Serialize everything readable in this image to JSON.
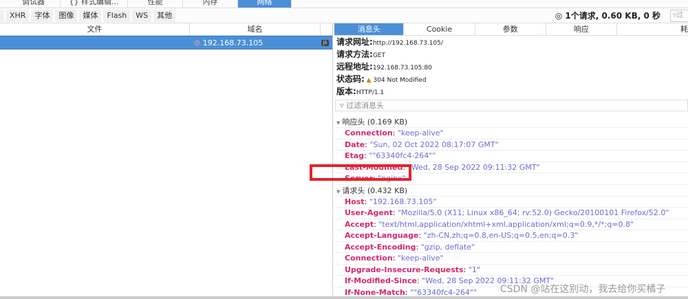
{
  "toolbox_tabs": [
    {
      "label": "调试器"
    },
    {
      "label": "{} 样式编辑..."
    },
    {
      "label": "性能"
    },
    {
      "label": "内存"
    },
    {
      "label": "网络"
    }
  ],
  "filters": [
    "XHR",
    "字体",
    "图像",
    "媒体",
    "Flash",
    "WS",
    "其他"
  ],
  "summary": "1个请求, 0.60 KB, 0 秒",
  "filter_urls_placeholder": "过",
  "columns": {
    "file": "文件",
    "domain": "域名"
  },
  "selected_request": {
    "domain": "192.168.73.105",
    "type_badge": "JS"
  },
  "detail_tabs": [
    "消息头",
    "Cookie",
    "参数",
    "响应",
    "耗"
  ],
  "summary_rows": [
    {
      "label": "请求网址:",
      "value": "http://192.168.73.105/"
    },
    {
      "label": "请求方法:",
      "value": "GET"
    },
    {
      "label": "远程地址:",
      "value": "192.168.73.105:80"
    },
    {
      "label": "状态码:",
      "value": "304  Not  Modified"
    },
    {
      "label": "版本:",
      "value": "HTTP/1.1"
    }
  ],
  "header_filter_placeholder": "过滤消息头",
  "response_headers": {
    "title": "响应头 (0.169 KB)",
    "items": [
      {
        "name": "Connection",
        "value": "\"keep-alive\""
      },
      {
        "name": "Date",
        "value": "\"Sun, 02 Oct 2022 08:17:07 GMT\""
      },
      {
        "name": "Etag",
        "value": "\"\"63340fc4-264\"\""
      },
      {
        "name": "Last-Modified",
        "value": "\"Wed, 28 Sep 2022 09:11:32 GMT\""
      },
      {
        "name": "Server",
        "value": "\"nginx\""
      }
    ]
  },
  "request_headers": {
    "title": "请求头 (0.432 KB)",
    "items": [
      {
        "name": "Host",
        "value": "\"192.168.73.105\""
      },
      {
        "name": "User-Agent",
        "value": "\"Mozilla/5.0 (X11; Linux x86_64; rv:52.0) Gecko/20100101 Firefox/52.0\""
      },
      {
        "name": "Accept",
        "value": "\"text/html,application/xhtml+xml,application/xml;q=0.9,*/*;q=0.8\""
      },
      {
        "name": "Accept-Language",
        "value": "\"zh-CN,zh;q=0.8,en-US;q=0.5,en;q=0.3\""
      },
      {
        "name": "Accept-Encoding",
        "value": "\"gzip, deflate\""
      },
      {
        "name": "Connection",
        "value": "\"keep-alive\""
      },
      {
        "name": "Upgrade-Insecure-Requests",
        "value": "\"1\""
      },
      {
        "name": "If-Modified-Since",
        "value": "\"Wed, 28 Sep 2022 09:11:32 GMT\""
      },
      {
        "name": "If-None-Match",
        "value": "\"\"63340fc4-264\"\""
      }
    ]
  },
  "watermark": "CSDN @站在这别动，我去给你买橘子"
}
